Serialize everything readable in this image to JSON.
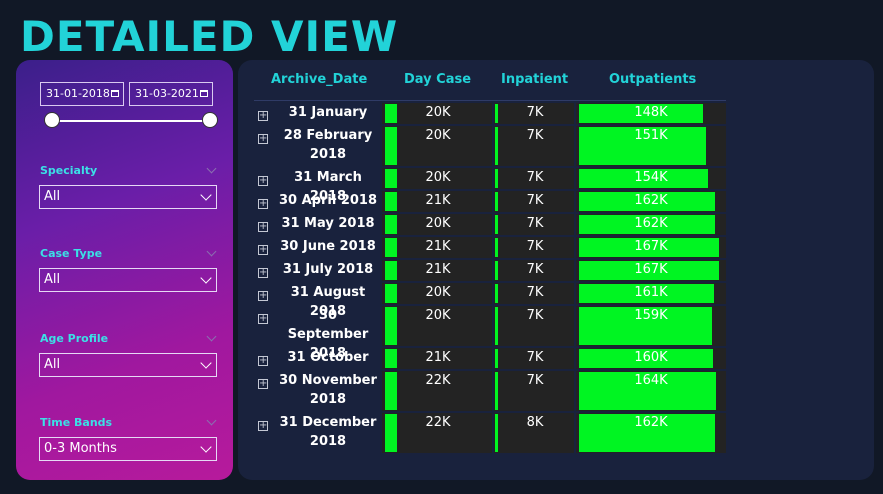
{
  "page_title": "DETAILED VIEW",
  "filters": {
    "date_from": "31-01-2018",
    "date_to": "31-03-2021",
    "specialty": {
      "label": "Specialty",
      "value": "All"
    },
    "case_type": {
      "label": "Case Type",
      "value": "All"
    },
    "age_profile": {
      "label": "Age Profile",
      "value": "All"
    },
    "time_bands": {
      "label": "Time Bands",
      "value": "0-3 Months"
    }
  },
  "table": {
    "columns": [
      "Archive_Date",
      "Day Case",
      "Inpatient",
      "Outpatients"
    ],
    "rows": [
      {
        "date": [
          "31 January"
        ],
        "day_case": "20K",
        "inpatient": "7K",
        "outpatients": "148K",
        "out_level": 148
      },
      {
        "date": [
          "28 February",
          "2018"
        ],
        "day_case": "20K",
        "inpatient": "7K",
        "outpatients": "151K",
        "out_level": 151
      },
      {
        "date": [
          "31 March 2018"
        ],
        "day_case": "20K",
        "inpatient": "7K",
        "outpatients": "154K",
        "out_level": 154
      },
      {
        "date": [
          "30 April 2018"
        ],
        "day_case": "21K",
        "inpatient": "7K",
        "outpatients": "162K",
        "out_level": 162
      },
      {
        "date": [
          "31 May 2018"
        ],
        "day_case": "20K",
        "inpatient": "7K",
        "outpatients": "162K",
        "out_level": 162
      },
      {
        "date": [
          "30 June 2018"
        ],
        "day_case": "21K",
        "inpatient": "7K",
        "outpatients": "167K",
        "out_level": 167
      },
      {
        "date": [
          "31 July 2018"
        ],
        "day_case": "21K",
        "inpatient": "7K",
        "outpatients": "167K",
        "out_level": 167
      },
      {
        "date": [
          "31 August 2018"
        ],
        "day_case": "20K",
        "inpatient": "7K",
        "outpatients": "161K",
        "out_level": 161
      },
      {
        "date": [
          "30 September",
          "2018"
        ],
        "day_case": "20K",
        "inpatient": "7K",
        "outpatients": "159K",
        "out_level": 159
      },
      {
        "date": [
          "31 October"
        ],
        "day_case": "21K",
        "inpatient": "7K",
        "outpatients": "160K",
        "out_level": 160
      },
      {
        "date": [
          "30 November",
          "2018"
        ],
        "day_case": "22K",
        "inpatient": "7K",
        "outpatients": "164K",
        "out_level": 164
      },
      {
        "date": [
          "31 December",
          "2018"
        ],
        "day_case": "22K",
        "inpatient": "8K",
        "outpatients": "162K",
        "out_level": 162
      }
    ]
  },
  "colors": {
    "accent": "#22d3d8",
    "bar": "#00f522",
    "panel": "#19223d",
    "background": "#111826"
  },
  "icons": {
    "calendar": "calendar-icon",
    "expand": "expand-plus-icon",
    "dropdown": "chevron-down-icon"
  }
}
